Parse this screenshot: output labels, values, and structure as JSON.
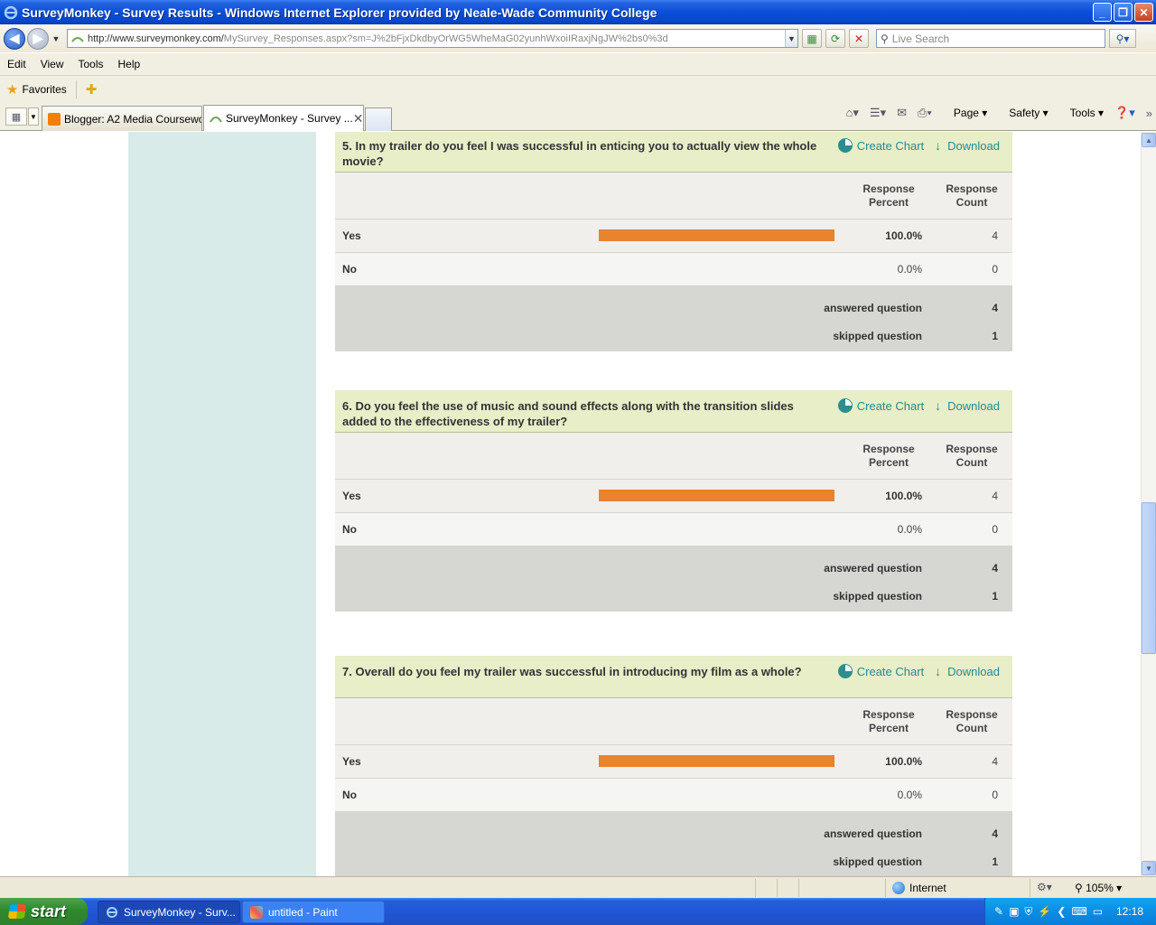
{
  "window": {
    "title": "SurveyMonkey - Survey Results - Windows Internet Explorer provided by Neale-Wade Community College"
  },
  "address": {
    "url_host": "http://www.surveymonkey.com/",
    "url_path": "MySurvey_Responses.aspx?sm=J%2bFjxDkdbyOrWG5WheMaG02yunhWxoiIRaxjNgJW%2bs0%3d",
    "search_placeholder": "Live Search"
  },
  "menu": [
    "Edit",
    "View",
    "Tools",
    "Help"
  ],
  "favorites": {
    "label": "Favorites"
  },
  "tabs": [
    {
      "title": "Blogger: A2 Media Coursewo..."
    },
    {
      "title": "SurveyMonkey - Survey ..."
    }
  ],
  "commands": {
    "page": "Page",
    "safety": "Safety",
    "tools": "Tools"
  },
  "questions": [
    {
      "text": "5. In my trailer do you feel I was successful in enticing you to actually view the whole movie?",
      "create_chart": "Create Chart",
      "download": "Download",
      "col_percent": "Response Percent",
      "col_count": "Response Count",
      "answers": [
        {
          "label": "Yes",
          "percent": "100.0%",
          "count": "4",
          "fraction": 1.0
        },
        {
          "label": "No",
          "percent": "0.0%",
          "count": "0",
          "fraction": 0.0
        }
      ],
      "answered_label": "answered question",
      "answered": "4",
      "skipped_label": "skipped question",
      "skipped": "1"
    },
    {
      "text": "6. Do you feel the use of music and sound effects along with the transition slides added to the effectiveness of my trailer?",
      "create_chart": "Create Chart",
      "download": "Download",
      "col_percent": "Response Percent",
      "col_count": "Response Count",
      "answers": [
        {
          "label": "Yes",
          "percent": "100.0%",
          "count": "4",
          "fraction": 1.0
        },
        {
          "label": "No",
          "percent": "0.0%",
          "count": "0",
          "fraction": 0.0
        }
      ],
      "answered_label": "answered question",
      "answered": "4",
      "skipped_label": "skipped question",
      "skipped": "1"
    },
    {
      "text": "7. Overall do you feel my trailer was successful in introducing my film as a whole?",
      "create_chart": "Create Chart",
      "download": "Download",
      "col_percent": "Response Percent",
      "col_count": "Response Count",
      "answers": [
        {
          "label": "Yes",
          "percent": "100.0%",
          "count": "4",
          "fraction": 1.0
        },
        {
          "label": "No",
          "percent": "0.0%",
          "count": "0",
          "fraction": 0.0
        }
      ],
      "answered_label": "answered question",
      "answered": "4",
      "skipped_label": "skipped question",
      "skipped": "1"
    }
  ],
  "status": {
    "zone": "Internet",
    "zoom": "105%"
  },
  "taskbar": {
    "start": "start",
    "items": [
      "SurveyMonkey - Surv...",
      "untitled - Paint"
    ],
    "clock": "12:18"
  },
  "colors": {
    "bar": "#e8832e",
    "header_bg": "#e7eec8",
    "sidebar_bg": "#d9ebe8",
    "link": "#2a8a8a"
  }
}
